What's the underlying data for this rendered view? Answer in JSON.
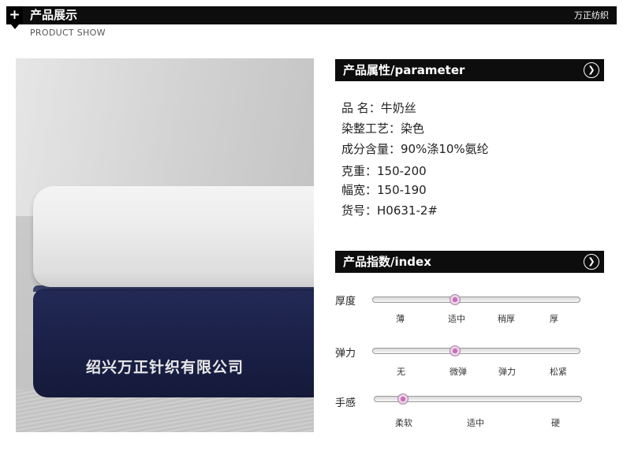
{
  "header": {
    "plus_glyph": "+",
    "title": "产品展示",
    "subtitle": "PRODUCT SHOW",
    "brand": "万正纺织"
  },
  "photo": {
    "watermark": "绍兴万正针织有限公司",
    "colors": {
      "white_fabric": "#ececec",
      "navy_fabric": "#1b2149"
    }
  },
  "parameter_section": {
    "title": "产品属性/parameter",
    "icon": "chevron-down-circle-icon",
    "rows": [
      "品 名：牛奶丝",
      "染整工艺：染色",
      "成分含量：90%涤10%氨纶",
      "克重：150-200",
      "幅宽：150-190",
      "货号：H0631-2#"
    ]
  },
  "index_section": {
    "title": "产品指数/index",
    "icon": "chevron-down-circle-icon",
    "indexes": [
      {
        "label": "厚度",
        "ticks": [
          "薄",
          "适中",
          "稍厚",
          "厚"
        ],
        "selected": "适中"
      },
      {
        "label": "弹力",
        "ticks": [
          "无",
          "微弹",
          "弹力",
          "松紧"
        ],
        "selected": "微弹"
      },
      {
        "label": "手感",
        "ticks": [
          "柔软",
          "适中",
          "硬"
        ],
        "selected": "柔软"
      }
    ]
  },
  "colors": {
    "header_bg": "#0d0d0d",
    "knob": "#c86fb8"
  }
}
